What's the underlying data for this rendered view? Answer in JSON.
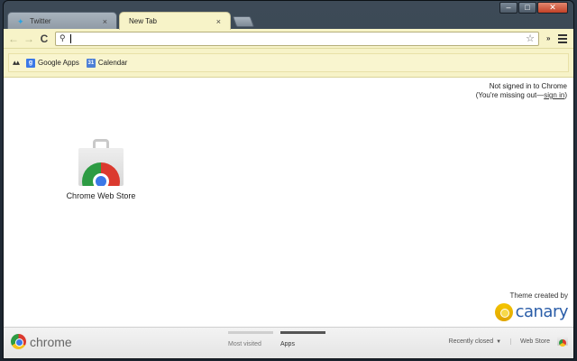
{
  "tabs": [
    {
      "label": "Twitter",
      "icon": "twitter-bird-icon",
      "close": "×"
    },
    {
      "label": "New Tab",
      "close": "×"
    }
  ],
  "caption_buttons": {
    "minimize": "–",
    "maximize": "□",
    "close": "✕"
  },
  "toolbar": {
    "back": "←",
    "forward": "→",
    "reload": "C",
    "omnibox_value": "",
    "omnibox_placeholder": "",
    "star": "☆",
    "extensions": "»"
  },
  "bookmarks": {
    "apps_glyph": "▴▴",
    "items": [
      {
        "label": "Google Apps",
        "icon": "google-apps-icon",
        "glyph": "g"
      },
      {
        "label": "Calendar",
        "icon": "calendar-icon",
        "glyph": "31"
      }
    ]
  },
  "signin": {
    "line1": "Not signed in to Chrome",
    "line2_prefix": "(You're missing out—",
    "link": "sign in",
    "line2_suffix": ")"
  },
  "apps": [
    {
      "label": "Chrome Web Store",
      "icon": "chrome-web-store-icon"
    }
  ],
  "theme": {
    "label": "Theme created by",
    "brand": "canary"
  },
  "footer": {
    "brand": "chrome",
    "switcher": [
      {
        "label": "Most visited",
        "active": false
      },
      {
        "label": "Apps",
        "active": true
      }
    ],
    "recently_closed": "Recently closed",
    "recently_closed_caret": "▼",
    "web_store": "Web Store"
  },
  "colors": {
    "theme_yellow": "#f7f3c8",
    "accent_blue": "#3b78e7",
    "canary_blue": "#2a5da8"
  }
}
